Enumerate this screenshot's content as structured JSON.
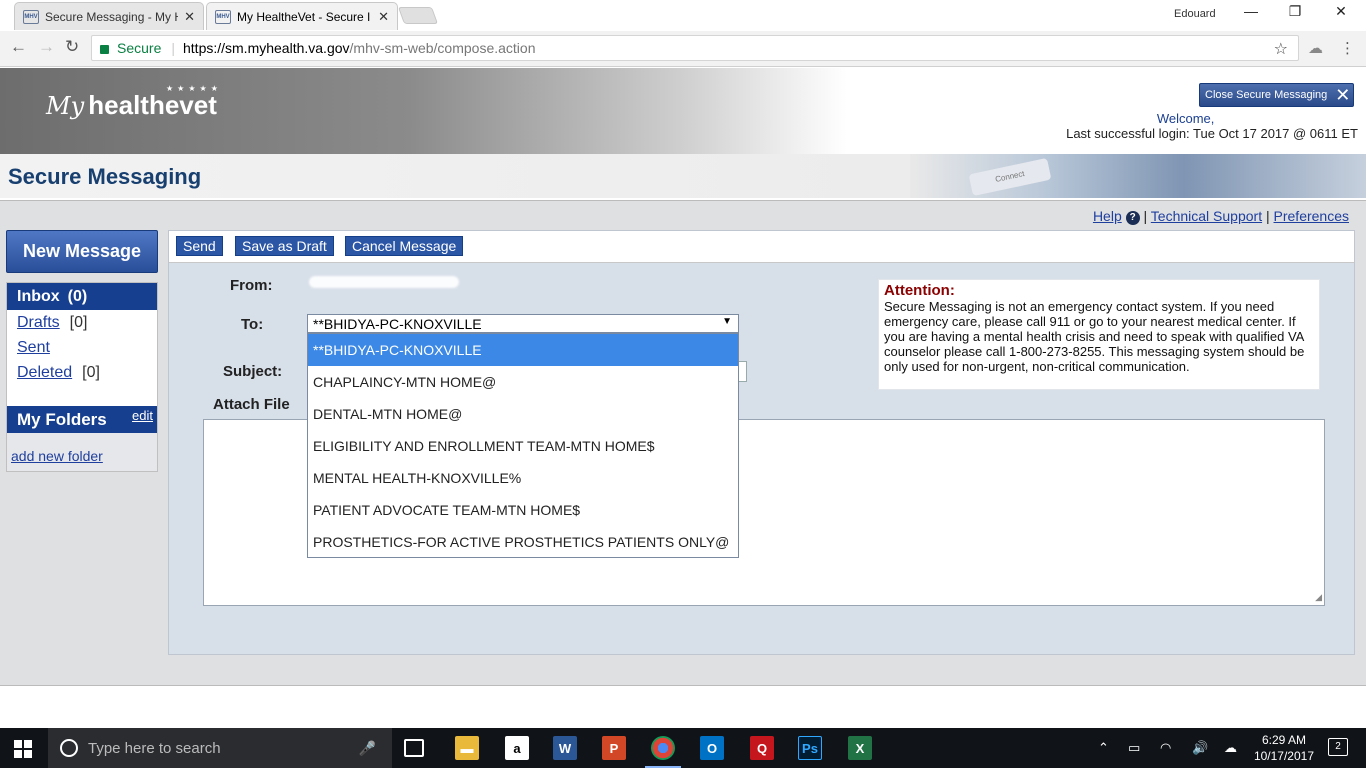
{
  "browser": {
    "tabs": [
      {
        "favicon": "MHV",
        "title": "Secure Messaging - My H"
      },
      {
        "favicon": "MHV",
        "title": "My HealtheVet - Secure I"
      }
    ],
    "user": "Edouard",
    "secure_label": "Secure",
    "url_scheme_host": "https://sm.myhealth.va.gov",
    "url_path": "/mhv-sm-web/compose.action"
  },
  "header": {
    "logo_my": "My",
    "logo_health": "healthevet",
    "close_label": "Close Secure Messaging",
    "welcome": "Welcome,",
    "last_login": "Last successful login: Tue Oct 17 2017 @ 0611 ET",
    "page_title": "Secure Messaging",
    "photo_keyboard_text": "Connect"
  },
  "toplinks": {
    "help": "Help",
    "tech_support": "Technical Support",
    "preferences": "Preferences",
    "separator": "|"
  },
  "sidebar": {
    "new_message": "New Message",
    "inbox": {
      "label": "Inbox",
      "count": "(0)"
    },
    "items": [
      {
        "label": "Drafts",
        "count": "[0]"
      },
      {
        "label": "Sent",
        "count": ""
      },
      {
        "label": "Deleted",
        "count": "[0]"
      }
    ],
    "folders_label": "My Folders",
    "edit": "edit",
    "add_folder": "add new folder"
  },
  "compose": {
    "buttons": {
      "send": "Send",
      "save_draft": "Save as Draft",
      "cancel": "Cancel Message"
    },
    "from_label": "From:",
    "to_label": "To:",
    "subject_label": "Subject:",
    "attach_label": "Attach File",
    "to_selected": "**BHIDYA-PC-KNOXVILLE",
    "recipients": [
      "**BHIDYA-PC-KNOXVILLE",
      "CHAPLAINCY-MTN HOME@",
      "DENTAL-MTN HOME@",
      "ELIGIBILITY AND ENROLLMENT TEAM-MTN HOME$",
      "MENTAL HEALTH-KNOXVILLE%",
      "PATIENT ADVOCATE TEAM-MTN HOME$",
      "PROSTHETICS-FOR ACTIVE PROSTHETICS PATIENTS ONLY@"
    ],
    "attention_title": "Attention:",
    "attention_text": "Secure Messaging is not an emergency contact system. If you need emergency care, please call 911 or go to your nearest medical center. If you are having a mental health crisis and need to speak with qualified VA counselor please call 1-800-273-8255. This messaging system should be only used for non-urgent, non-critical communication."
  },
  "taskbar": {
    "search_placeholder": "Type here to search",
    "time": "6:29 AM",
    "date": "10/17/2017",
    "notifications": "2"
  }
}
